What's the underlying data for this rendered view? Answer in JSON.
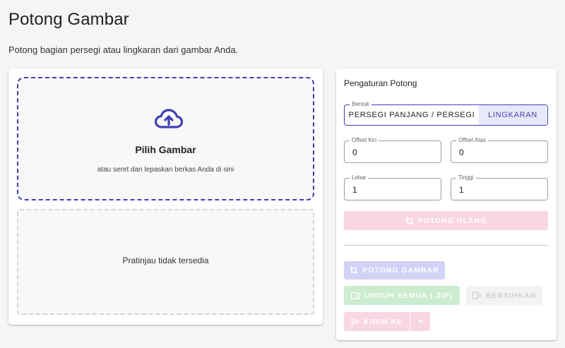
{
  "page": {
    "title": "Potong Gambar",
    "description": "Potong bagian persegi atau lingkaran dari gambar Anda."
  },
  "upload": {
    "icon": "cloud-upload-icon",
    "title": "Pilih Gambar",
    "subtitle": "atau seret dan lepaskan berkas Anda di sini"
  },
  "preview": {
    "text": "Pratinjau tidak tersedia"
  },
  "settings": {
    "title": "Pengaturan Potong",
    "shape": {
      "label": "Bentuk",
      "options": [
        "PERSEGI PANJANG / PERSEGI",
        "LINGKARAN"
      ],
      "selected": "LINGKARAN"
    },
    "offset_left": {
      "label": "Offset Kiri",
      "value": "0"
    },
    "offset_top": {
      "label": "Offset Atas",
      "value": "0"
    },
    "width": {
      "label": "Lebar",
      "value": "1"
    },
    "height": {
      "label": "Tinggi",
      "value": "1"
    },
    "recrop_button": "POTONG ULANG"
  },
  "actions": {
    "crop_button": "POTONG GAMBAR",
    "download_all_button": "UNDUH SEMUA (.ZIP)",
    "clear_button": "BERSIHKAN",
    "send_to_button": "KIRIM KE"
  },
  "colors": {
    "accent": "#3f3fb5",
    "background": "#f5f5f5",
    "pink_disabled": "#f8d6e3",
    "green_disabled": "#cbeccf",
    "indigo_disabled": "#d2d2f7"
  }
}
